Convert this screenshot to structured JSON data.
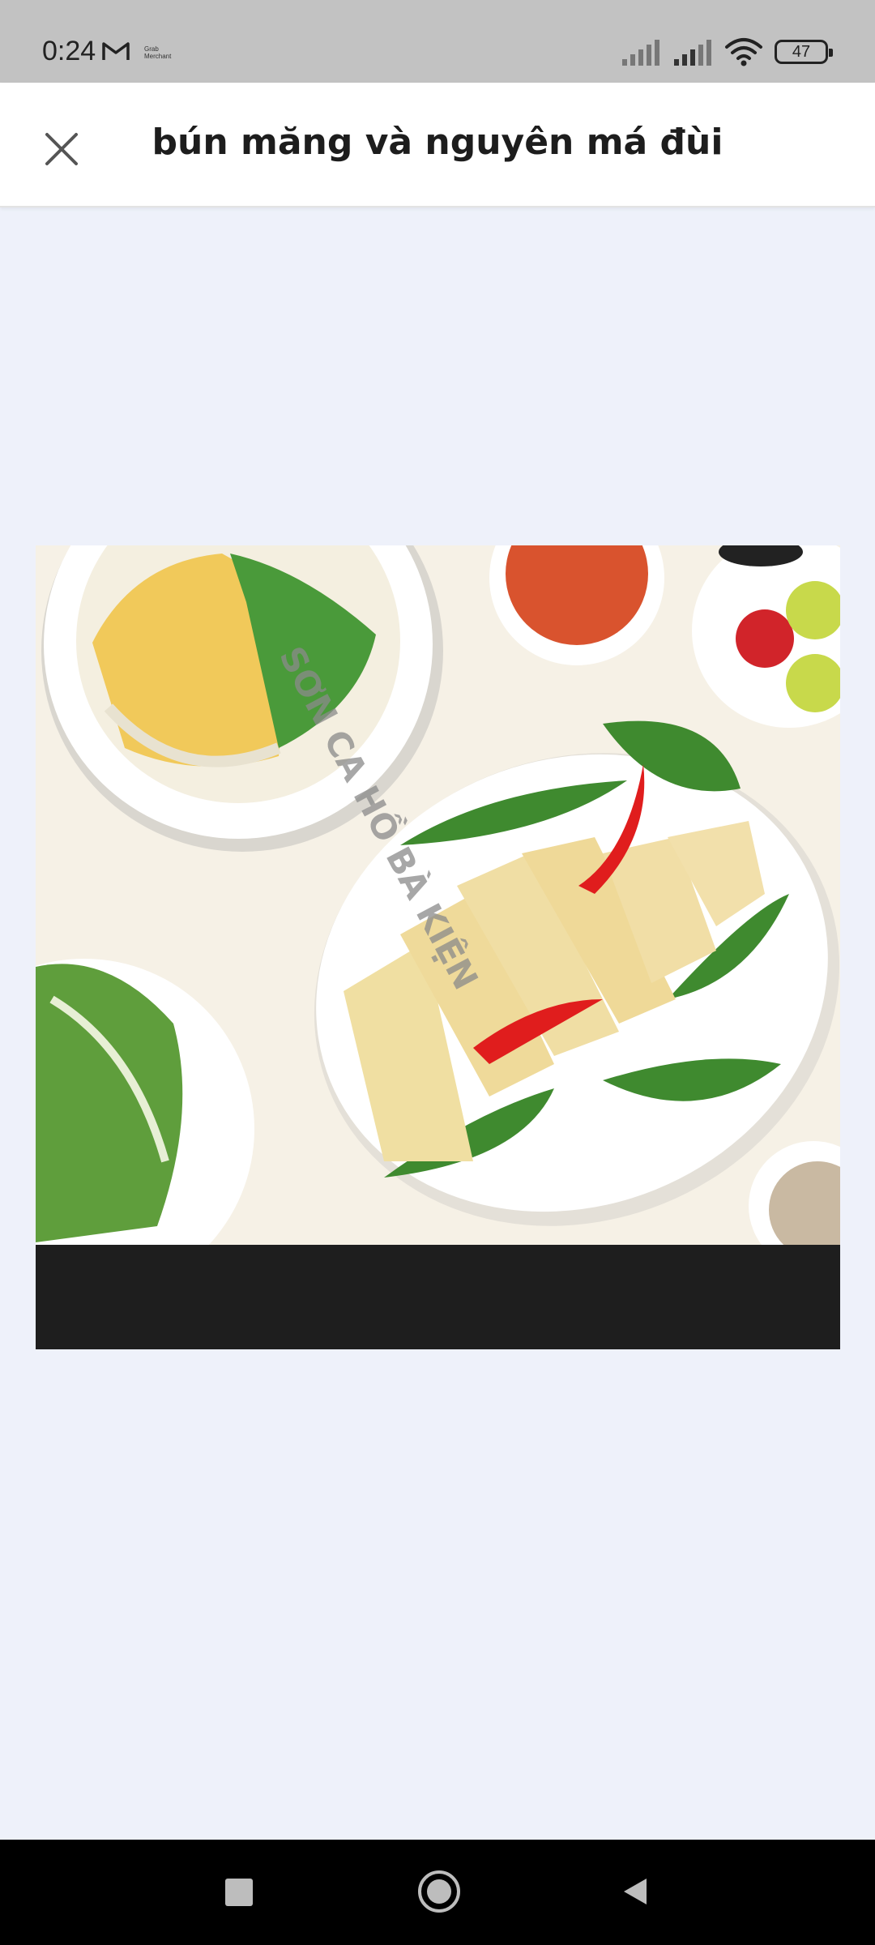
{
  "status_bar": {
    "time": "0:24",
    "mail_icon": "gmail-icon",
    "grab_label": "Grab Merchant",
    "battery": "47",
    "signal_icons": [
      "signal-icon",
      "signal-icon"
    ],
    "wifi_icon": "wifi-icon"
  },
  "header": {
    "title": "bún măng và nguyên má đùi",
    "close_icon": "close-icon"
  },
  "photo": {
    "watermark": "SƠN CA HỒ BÀ KIỆN",
    "description_icon": "food-photo"
  },
  "nav_bar": {
    "recents_icon": "square-icon",
    "home_icon": "circle-icon",
    "back_icon": "triangle-back-icon"
  },
  "colors": {
    "page_bg": "#eef1fa",
    "status_bar_bg": "#c2c2c2",
    "header_bg": "#ffffff",
    "nav_bg": "#000000"
  }
}
